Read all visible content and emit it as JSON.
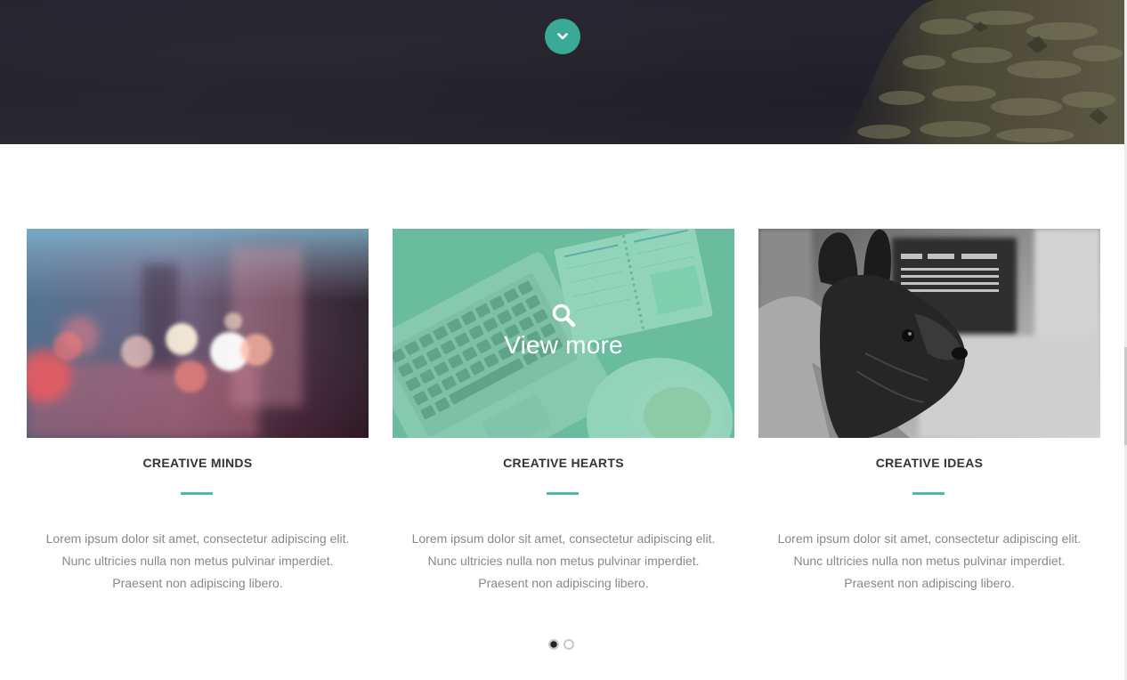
{
  "hero": {
    "scroll_button_icon": "chevron-down-icon",
    "accent_color": "#3aaa97"
  },
  "cards": [
    {
      "title": "CREATIVE MINDS",
      "image": "blurred-city-lights-photo",
      "lines": [
        "Lorem ipsum dolor sit amet, consectetur adipiscing elit.",
        "Nunc ultricies nulla non metus pulvinar imperdiet.",
        "Praesent non adipiscing libero."
      ]
    },
    {
      "title": "CREATIVE HEARTS",
      "image": "laptop-notebook-coffee-photo",
      "overlay_label": "View more",
      "overlay_icon": "search-icon",
      "lines": [
        "Lorem ipsum dolor sit amet, consectetur adipiscing elit.",
        "Nunc ultricies nulla non metus pulvinar imperdiet.",
        "Praesent non adipiscing libero."
      ]
    },
    {
      "title": "CREATIVE IDEAS",
      "image": "french-bulldog-photo",
      "lines": [
        "Lorem ipsum dolor sit amet, consectetur adipiscing elit.",
        "Nunc ultricies nulla non metus pulvinar imperdiet.",
        "Praesent non adipiscing libero."
      ]
    }
  ],
  "pager": {
    "pages": 2,
    "active_page": 1
  },
  "colors": {
    "accent": "#46bcaa",
    "overlay": "#6ec8a5",
    "title": "#333333",
    "body_text": "#888888"
  }
}
